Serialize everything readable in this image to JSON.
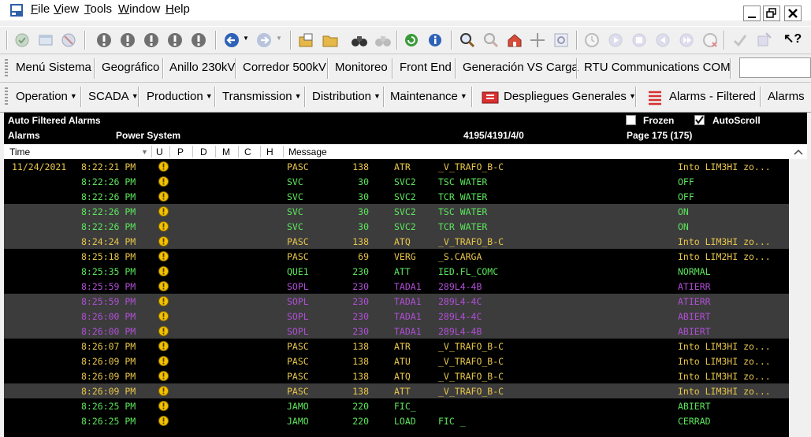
{
  "menu": {
    "file": {
      "u": "F",
      "rest": "ile"
    },
    "view": {
      "u": "V",
      "rest": "iew"
    },
    "tools": {
      "u": "T",
      "rest": "ools"
    },
    "window": {
      "u": "W",
      "rest": "indow"
    },
    "help": {
      "u": "H",
      "rest": "elp"
    }
  },
  "quick_displays": [
    "Menú Sistema",
    "Geográfico",
    "Anillo 230kV",
    "Corredor 500kV",
    "Monitoreo",
    "Front End",
    "Generación VS Carga",
    "RTU Communications COM"
  ],
  "display_menus": [
    "Operation",
    "SCADA",
    "Production",
    "Transmission",
    "Distribution",
    "Maintenance",
    "Despliegues Generales"
  ],
  "alarms_filtered_label": "Alarms - Filtered",
  "alarms_label": "Alarms",
  "alarm_header": {
    "title": "Auto Filtered Alarms",
    "subtitle": "Alarms",
    "area": "Power System",
    "counts": "4195/4191/4/0",
    "page": "Page 175 (175)",
    "frozen_label": "Frozen",
    "frozen": false,
    "autoscroll_label": "AutoScroll",
    "autoscroll": true
  },
  "columns": {
    "time": "Time",
    "u": "U",
    "p": "P",
    "d": "D",
    "m": "M",
    "c": "C",
    "h": "H",
    "message": "Message"
  },
  "colors": {
    "yellow": "#e8c64a",
    "green": "#5ce65c",
    "purple": "#b04fd6",
    "dark_row": "#000000",
    "light_row": "#3c3c3c"
  },
  "rows": [
    {
      "date": "11/24/2021",
      "time": "8:22:21 PM",
      "station": "PASC",
      "kv": "138",
      "dev": "ATR",
      "point": "_V_TRAFO_B-C",
      "status": "Into LIM3HI zo...",
      "color": "yellow",
      "shade": "dark"
    },
    {
      "date": "",
      "time": "8:22:26 PM",
      "station": "SVC",
      "kv": "30",
      "dev": "SVC2",
      "point": "TSC WATER",
      "status": "OFF",
      "color": "green",
      "shade": "dark"
    },
    {
      "date": "",
      "time": "8:22:26 PM",
      "station": "SVC",
      "kv": "30",
      "dev": "SVC2",
      "point": "TCR WATER",
      "status": "OFF",
      "color": "green",
      "shade": "dark"
    },
    {
      "date": "",
      "time": "8:22:26 PM",
      "station": "SVC",
      "kv": "30",
      "dev": "SVC2",
      "point": "TSC WATER",
      "status": "ON",
      "color": "green",
      "shade": "light"
    },
    {
      "date": "",
      "time": "8:22:26 PM",
      "station": "SVC",
      "kv": "30",
      "dev": "SVC2",
      "point": "TCR WATER",
      "status": "ON",
      "color": "green",
      "shade": "light"
    },
    {
      "date": "",
      "time": "8:24:24 PM",
      "station": "PASC",
      "kv": "138",
      "dev": "ATQ",
      "point": "_V_TRAFO_B-C",
      "status": "Into LIM3HI zo...",
      "color": "yellow",
      "shade": "light"
    },
    {
      "date": "",
      "time": "8:25:18 PM",
      "station": "PASC",
      "kv": "69",
      "dev": "VERG",
      "point": "_S.CARGA",
      "status": "Into LIM2HI zo...",
      "color": "yellow",
      "shade": "dark"
    },
    {
      "date": "",
      "time": "8:25:35 PM",
      "station": "QUE1",
      "kv": "230",
      "dev": "ATT",
      "point": "IED.FL_COMC",
      "status": "NORMAL",
      "color": "green",
      "shade": "dark"
    },
    {
      "date": "",
      "time": "8:25:59 PM",
      "station": "SOPL",
      "kv": "230",
      "dev": "TADA1",
      "point": "289L4-4B",
      "status": "ATIERR",
      "color": "purple",
      "shade": "dark"
    },
    {
      "date": "",
      "time": "8:25:59 PM",
      "station": "SOPL",
      "kv": "230",
      "dev": "TADA1",
      "point": "289L4-4C",
      "status": "ATIERR",
      "color": "purple",
      "shade": "light"
    },
    {
      "date": "",
      "time": "8:26:00 PM",
      "station": "SOPL",
      "kv": "230",
      "dev": "TADA1",
      "point": "289L4-4C",
      "status": "ABIERT",
      "color": "purple",
      "shade": "light"
    },
    {
      "date": "",
      "time": "8:26:00 PM",
      "station": "SOPL",
      "kv": "230",
      "dev": "TADA1",
      "point": "289L4-4B",
      "status": "ABIERT",
      "color": "purple",
      "shade": "light"
    },
    {
      "date": "",
      "time": "8:26:07 PM",
      "station": "PASC",
      "kv": "138",
      "dev": "ATR",
      "point": "_V_TRAFO_B-C",
      "status": "Into LIM3HI zo...",
      "color": "yellow",
      "shade": "dark"
    },
    {
      "date": "",
      "time": "8:26:09 PM",
      "station": "PASC",
      "kv": "138",
      "dev": "ATU",
      "point": "_V_TRAFO_B-C",
      "status": "Into LIM3HI zo...",
      "color": "yellow",
      "shade": "dark"
    },
    {
      "date": "",
      "time": "8:26:09 PM",
      "station": "PASC",
      "kv": "138",
      "dev": "ATQ",
      "point": "_V_TRAFO_B-C",
      "status": "Into LIM3HI zo...",
      "color": "yellow",
      "shade": "dark"
    },
    {
      "date": "",
      "time": "8:26:09 PM",
      "station": "PASC",
      "kv": "138",
      "dev": "ATT",
      "point": "_V_TRAFO_B-C",
      "status": "Into LIM3HI zo...",
      "color": "yellow",
      "shade": "light"
    },
    {
      "date": "",
      "time": "8:26:25 PM",
      "station": "JAMO",
      "kv": "220",
      "dev": "FIC_",
      "point": "",
      "status": "ABIERT",
      "color": "green",
      "shade": "dark"
    },
    {
      "date": "",
      "time": "8:26:25 PM",
      "station": "JAMO",
      "kv": "220",
      "dev": "LOAD",
      "point": "FIC _",
      "status": "CERRAD",
      "color": "green",
      "shade": "dark"
    }
  ]
}
